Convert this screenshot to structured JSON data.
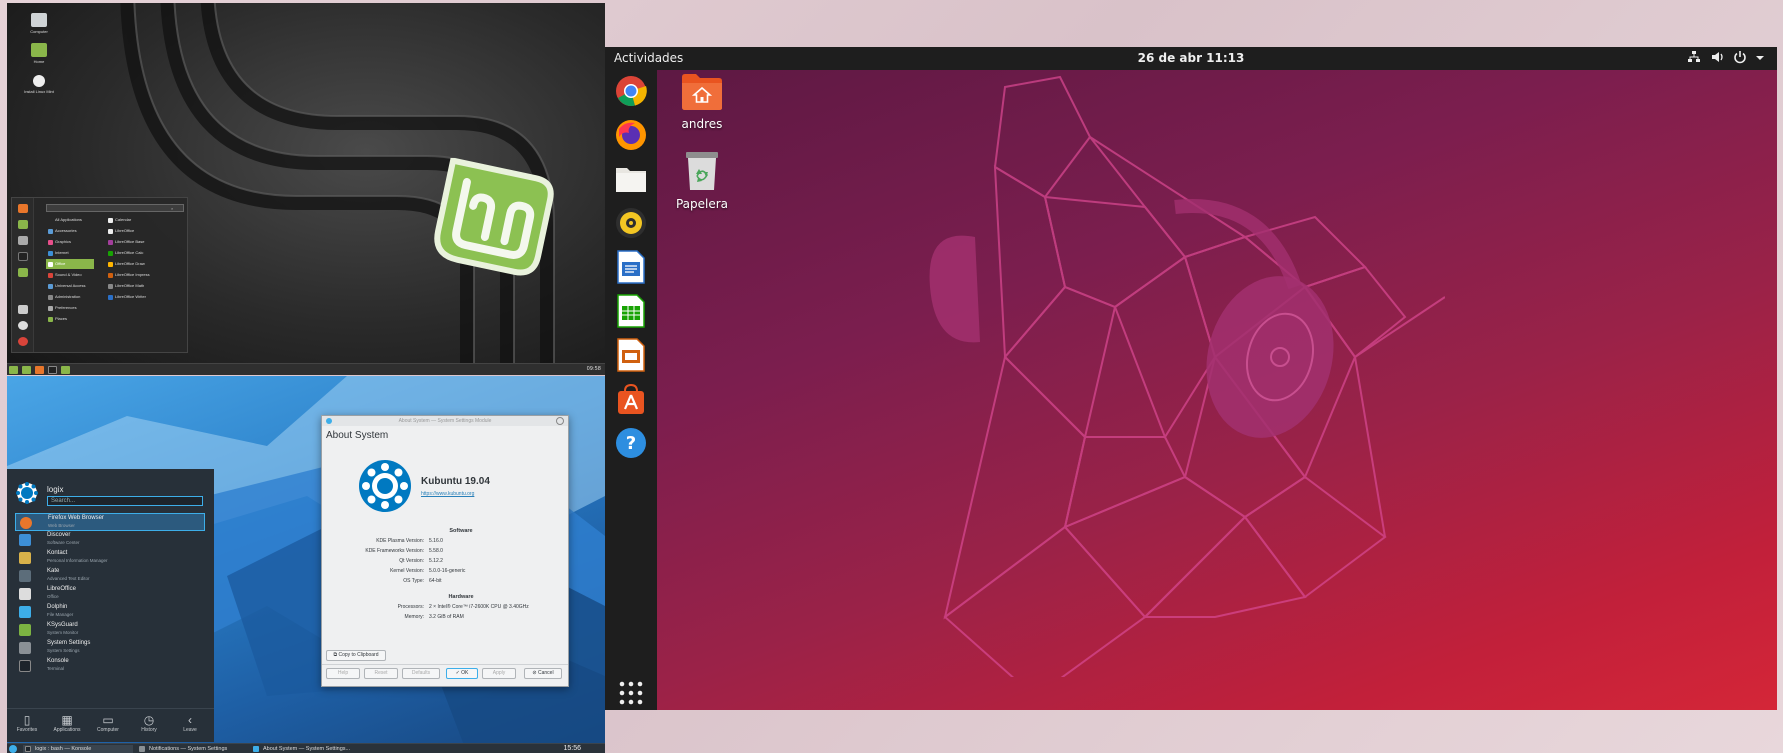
{
  "mint": {
    "desktop_icons": [
      "Computer",
      "Home",
      "Install Linux Mint"
    ],
    "menu": {
      "categories": [
        "All Applications",
        "Accessories",
        "Graphics",
        "Internet",
        "Office",
        "Sound & Video",
        "Universal Access",
        "Administration",
        "Preferences",
        "Places"
      ],
      "selected_category": 4,
      "apps": [
        "Calendar",
        "LibreOffice",
        "LibreOffice Base",
        "LibreOffice Calc",
        "LibreOffice Draw",
        "LibreOffice Impress",
        "LibreOffice Math",
        "LibreOffice Writer"
      ]
    },
    "panel_clock": "09:58"
  },
  "kde": {
    "menu": {
      "username": "logix",
      "search_placeholder": "Search...",
      "items": [
        {
          "title": "Firefox Web Browser",
          "subtitle": "Web Browser",
          "color": "#e8762b"
        },
        {
          "title": "Discover",
          "subtitle": "Software Center",
          "color": "#3d8fd6"
        },
        {
          "title": "Kontact",
          "subtitle": "Personal Information Manager",
          "color": "#d9b24a"
        },
        {
          "title": "Kate",
          "subtitle": "Advanced Text Editor",
          "color": "#5c6d7a"
        },
        {
          "title": "LibreOffice",
          "subtitle": "Office",
          "color": "#dddddd"
        },
        {
          "title": "Dolphin",
          "subtitle": "File Manager",
          "color": "#3daee9"
        },
        {
          "title": "KSysGuard",
          "subtitle": "System Monitor",
          "color": "#7cb342"
        },
        {
          "title": "System Settings",
          "subtitle": "System Settings",
          "color": "#8a9095"
        },
        {
          "title": "Konsole",
          "subtitle": "Terminal",
          "color": "#333b42"
        }
      ],
      "tabs": [
        "Favorites",
        "Applications",
        "Computer",
        "History",
        "Leave"
      ]
    },
    "dialog": {
      "window_title": "About System — System Settings Module",
      "heading": "About System",
      "product": "Kubuntu 19.04",
      "url": "https://www.kubuntu.org",
      "software_heading": "Software",
      "software": [
        {
          "key": "KDE Plasma Version:",
          "value": "5.16.0"
        },
        {
          "key": "KDE Frameworks Version:",
          "value": "5.58.0"
        },
        {
          "key": "Qt Version:",
          "value": "5.12.2"
        },
        {
          "key": "Kernel Version:",
          "value": "5.0.0-16-generic"
        },
        {
          "key": "OS Type:",
          "value": "64-bit"
        }
      ],
      "hardware_heading": "Hardware",
      "hardware": [
        {
          "key": "Processors:",
          "value": "2 × Intel® Core™ i7-2600K CPU @ 3.40GHz"
        },
        {
          "key": "Memory:",
          "value": "3.2 GiB of RAM"
        }
      ],
      "copy_label": "Copy to Clipboard",
      "buttons": {
        "help": "Help",
        "reset": "Reset",
        "defaults": "Defaults",
        "ok": "OK",
        "apply": "Apply",
        "cancel": "Cancel"
      }
    },
    "taskbar": {
      "tasks": [
        "logix : bash — Konsole",
        "Notifications — System Settings",
        "About System — System Settings..."
      ],
      "clock": "15:56"
    }
  },
  "ubuntu": {
    "activities": "Actividades",
    "clock": "26 de abr  11:13",
    "tray_icons": [
      "network-icon",
      "volume-icon",
      "power-icon",
      "dropdown-icon"
    ],
    "dock_apps": [
      "Google Chrome",
      "Firefox",
      "Files",
      "Rhythmbox",
      "LibreOffice Writer",
      "LibreOffice Calc",
      "LibreOffice Impress",
      "Ubuntu Software",
      "Help"
    ],
    "desktop_icons": [
      {
        "label": "andres"
      },
      {
        "label": "Papelera"
      }
    ],
    "colors": {
      "accent": "#e95420",
      "topbar": "#1e1e1e"
    }
  }
}
